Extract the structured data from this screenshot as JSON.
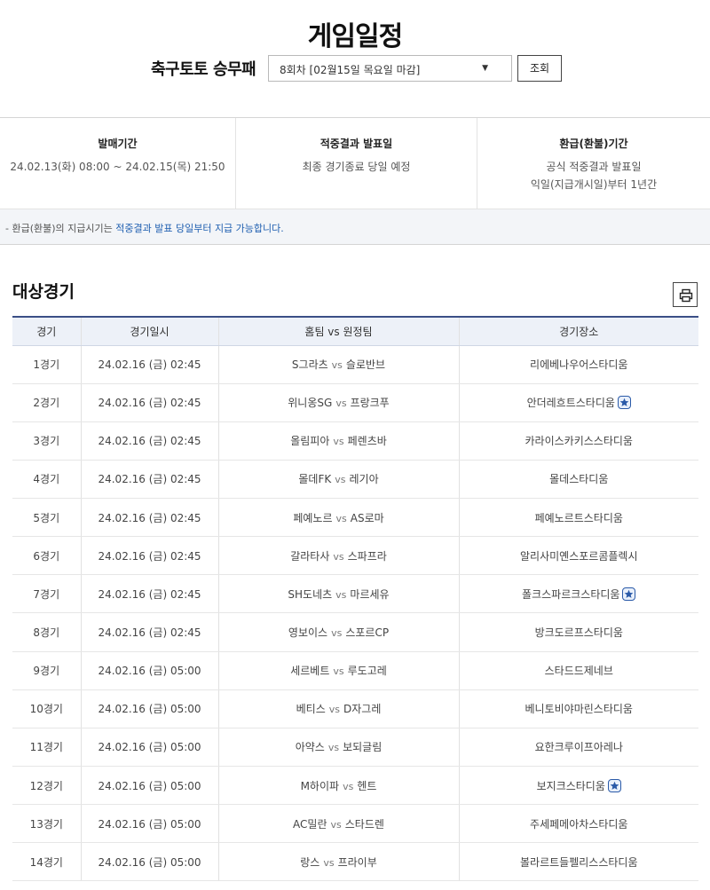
{
  "page_title": "게임일정",
  "selector": {
    "game_name": "축구토토 승무패",
    "round_value": "8회차 [02월15일 목요일 마감]",
    "query_label": "조회"
  },
  "info": {
    "sale_period": {
      "title": "발매기간",
      "lines": [
        "24.02.13(화) 08:00 ~ 24.02.15(목) 21:50"
      ]
    },
    "result_date": {
      "title": "적중결과 발표일",
      "lines": [
        "최종 경기종료 당일 예정"
      ]
    },
    "refund_period": {
      "title": "환급(환불)기간",
      "lines": [
        "공식 적중결과 발표일",
        "익일(지급개시일)부터 1년간"
      ]
    },
    "note_prefix": "- 환급(환불)의 지급시기는 ",
    "note_highlight": "적중결과 발표 당일부터 지급 가능합니다."
  },
  "section_title": "대상경기",
  "table": {
    "headers": [
      "경기",
      "경기일시",
      "홈팀  vs  원정팀",
      "경기장소"
    ],
    "vs_label": "vs",
    "rows": [
      {
        "no": "1경기",
        "datetime": "24.02.16 (금) 02:45",
        "home": "S그라츠",
        "away": "슬로반브",
        "venue": "리에베나우어스타디움",
        "star": false
      },
      {
        "no": "2경기",
        "datetime": "24.02.16 (금) 02:45",
        "home": "위니옹SG",
        "away": "프랑크푸",
        "venue": "안더레흐트스타디움",
        "star": true
      },
      {
        "no": "3경기",
        "datetime": "24.02.16 (금) 02:45",
        "home": "올림피아",
        "away": "페렌츠바",
        "venue": "카라이스카키스스타디움",
        "star": false
      },
      {
        "no": "4경기",
        "datetime": "24.02.16 (금) 02:45",
        "home": "몰데FK",
        "away": "레기아",
        "venue": "몰데스타디움",
        "star": false
      },
      {
        "no": "5경기",
        "datetime": "24.02.16 (금) 02:45",
        "home": "페예노르",
        "away": "AS로마",
        "venue": "페예노르트스타디움",
        "star": false
      },
      {
        "no": "6경기",
        "datetime": "24.02.16 (금) 02:45",
        "home": "갈라타사",
        "away": "스파프라",
        "venue": "알리사미옌스포르콤플렉시",
        "star": false
      },
      {
        "no": "7경기",
        "datetime": "24.02.16 (금) 02:45",
        "home": "SH도네츠",
        "away": "마르세유",
        "venue": "폴크스파르크스타디움",
        "star": true
      },
      {
        "no": "8경기",
        "datetime": "24.02.16 (금) 02:45",
        "home": "영보이스",
        "away": "스포르CP",
        "venue": "방크도르프스타디움",
        "star": false
      },
      {
        "no": "9경기",
        "datetime": "24.02.16 (금) 05:00",
        "home": "세르베트",
        "away": "루도고레",
        "venue": "스타드드제네브",
        "star": false
      },
      {
        "no": "10경기",
        "datetime": "24.02.16 (금) 05:00",
        "home": "베티스",
        "away": "D자그레",
        "venue": "베니토비야마린스타디움",
        "star": false
      },
      {
        "no": "11경기",
        "datetime": "24.02.16 (금) 05:00",
        "home": "아약스",
        "away": "보되글림",
        "venue": "요한크루이프아레나",
        "star": false
      },
      {
        "no": "12경기",
        "datetime": "24.02.16 (금) 05:00",
        "home": "M하이파",
        "away": "헨트",
        "venue": "보지크스타디움",
        "star": true
      },
      {
        "no": "13경기",
        "datetime": "24.02.16 (금) 05:00",
        "home": "AC밀란",
        "away": "스타드렌",
        "venue": "주세페메아차스타디움",
        "star": false
      },
      {
        "no": "14경기",
        "datetime": "24.02.16 (금) 05:00",
        "home": "랑스",
        "away": "프라이부",
        "venue": "볼라르트들펠리스스타디움",
        "star": false
      }
    ]
  },
  "colors": {
    "accent": "#3b4f86",
    "header_bg": "#edf1f8",
    "note_bg": "#f3f5f8",
    "star": "#2a5aa8"
  },
  "icons": {
    "print": "printer-icon",
    "venue_badge": "star-icon",
    "select": "chevron-down-icon"
  }
}
